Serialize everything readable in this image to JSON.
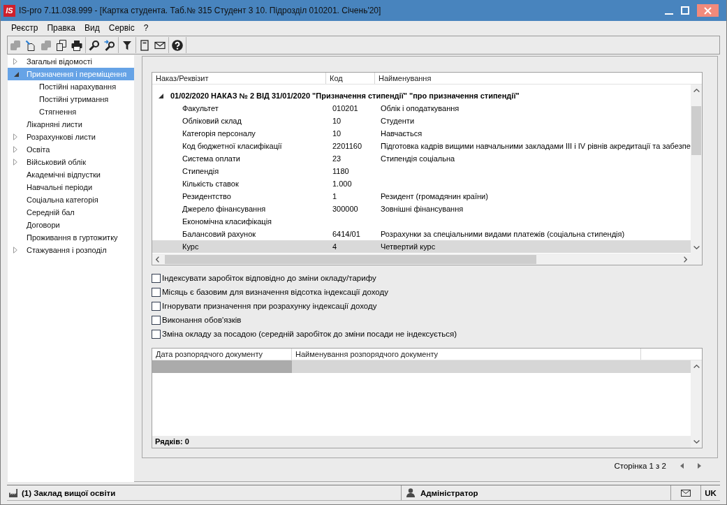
{
  "window": {
    "logo": "IS",
    "title": "IS-pro 7.11.038.999 - [Картка студента. Таб.№ 315 Студент 3 10. Підрозділ 010201. Січень'20]"
  },
  "menu": [
    "Реєстр",
    "Правка",
    "Вид",
    "Сервіс",
    "?"
  ],
  "toolbar": [
    [
      {
        "kind": "stack",
        "disabled": true
      },
      {
        "kind": "new",
        "disabled": false
      },
      {
        "kind": "stack",
        "disabled": true
      },
      {
        "kind": "copy",
        "disabled": false
      },
      {
        "kind": "print",
        "disabled": false
      }
    ],
    [
      {
        "kind": "search",
        "disabled": false
      },
      {
        "kind": "search-next",
        "disabled": false
      }
    ],
    [
      {
        "kind": "filter",
        "disabled": false
      }
    ],
    [
      {
        "kind": "page",
        "disabled": false
      },
      {
        "kind": "mail",
        "disabled": false
      }
    ],
    [
      {
        "kind": "help",
        "disabled": false
      }
    ]
  ],
  "sidebar": {
    "items": [
      {
        "label": "Загальні відомості",
        "expandable": true,
        "expanded": false,
        "selected": false
      },
      {
        "label": "Призначення і переміщення",
        "expandable": true,
        "expanded": true,
        "selected": true,
        "children": [
          {
            "label": "Постійні нарахування",
            "expandable": false,
            "expanded": false,
            "selected": false
          },
          {
            "label": "Постійні утримання",
            "expandable": false,
            "expanded": false,
            "selected": false
          },
          {
            "label": "Стягнення",
            "expandable": false,
            "expanded": false,
            "selected": false
          }
        ]
      },
      {
        "label": "Лікарняні листи",
        "expandable": false,
        "expanded": false,
        "selected": false
      },
      {
        "label": "Розрахункові листи",
        "expandable": true,
        "expanded": false,
        "selected": false
      },
      {
        "label": "Освіта",
        "expandable": true,
        "expanded": false,
        "selected": false
      },
      {
        "label": "Військовий облік",
        "expandable": true,
        "expanded": false,
        "selected": false
      },
      {
        "label": "Академічні відпустки",
        "expandable": false,
        "expanded": false,
        "selected": false
      },
      {
        "label": "Навчальні періоди",
        "expandable": false,
        "expanded": false,
        "selected": false
      },
      {
        "label": "Соціальна категорія",
        "expandable": false,
        "expanded": false,
        "selected": false
      },
      {
        "label": "Середній бал",
        "expandable": false,
        "expanded": false,
        "selected": false
      },
      {
        "label": "Договори",
        "expandable": false,
        "expanded": false,
        "selected": false
      },
      {
        "label": "Проживання в гуртожитку",
        "expandable": false,
        "expanded": false,
        "selected": false
      },
      {
        "label": "Стажування і розподіл",
        "expandable": true,
        "expanded": false,
        "selected": false
      }
    ]
  },
  "orders_table": {
    "columns": [
      "Наказ/Реквізит",
      "Код",
      "Найменування"
    ],
    "groups": [
      {
        "title": "01/02/2020 НАКАЗ № 2 ВІД 31/01/2020 \"Призначення стипендії\" \"про призначення стипендії\"",
        "expanded": true,
        "rows": [
          {
            "requisite": "Факультет",
            "code": "010201",
            "name": "Облік і оподаткування",
            "selected": false
          },
          {
            "requisite": "Обліковий склад",
            "code": "10",
            "name": "Студенти",
            "selected": false
          },
          {
            "requisite": "Категорія персоналу",
            "code": "10",
            "name": "Навчається",
            "selected": false
          },
          {
            "requisite": "Код бюджетної класифікації",
            "code": "2201160",
            "name": "Підготовка кадрів вищими навчальними закладами III і IV рівнів акредитації та забезпе",
            "selected": false
          },
          {
            "requisite": "Система оплати",
            "code": "23",
            "name": "Стипендія соціальна",
            "selected": false
          },
          {
            "requisite": "Стипендія",
            "code": "1180",
            "selected": false
          },
          {
            "requisite": "Кількість ставок",
            "code": "1.000",
            "selected": false
          },
          {
            "requisite": "Резидентство",
            "code": "1",
            "name": "Резидент (громадянин країни)",
            "selected": false
          },
          {
            "requisite": "Джерело фінансування",
            "code": "300000",
            "name": "Зовнішні фінансування",
            "selected": false
          },
          {
            "requisite": "Економічна класифікація",
            "selected": false
          },
          {
            "requisite": "Балансовий рахунок",
            "code": "6414/01",
            "name": "Розрахунки за спеціальними видами платежів (соціальна стипендія)",
            "selected": false
          },
          {
            "requisite": "Курс",
            "code": "4",
            "name": "Четвертий курс",
            "selected": true
          }
        ]
      }
    ]
  },
  "options": [
    {
      "label": "Індексувати заробіток відповідно до зміни окладу/тарифу",
      "checked": false
    },
    {
      "label": "Місяць є базовим для визначення відсотка індексації доходу",
      "checked": false
    },
    {
      "label": "Ігнорувати призначення при розрахунку індексації доходу",
      "checked": false
    },
    {
      "label": "Виконання обов'язків",
      "checked": false
    },
    {
      "label": "Зміна окладу за посадою (середній заробіток до зміни посади не індексується)",
      "checked": false
    }
  ],
  "documents_table": {
    "columns": [
      "Дата розпорядчого документу",
      "Найменування розпорядчого документу"
    ],
    "footer": "Рядків: 0"
  },
  "pagination": {
    "label": "Сторінка 1 з 2"
  },
  "status_bar": {
    "organization": "(1) Заклад вищої освіти",
    "user": "Адміністратор",
    "language": "UK"
  }
}
